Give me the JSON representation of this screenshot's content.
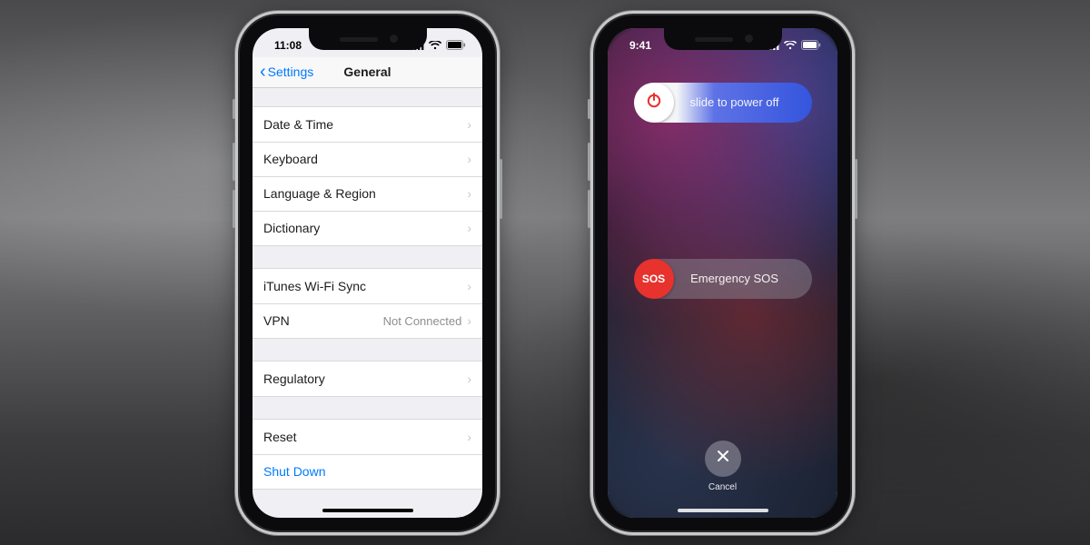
{
  "settings": {
    "status_time": "11:08",
    "back_label": "Settings",
    "title": "General",
    "rows": {
      "date_time": "Date & Time",
      "keyboard": "Keyboard",
      "language_region": "Language & Region",
      "dictionary": "Dictionary",
      "itunes_wifi": "iTunes Wi-Fi Sync",
      "vpn": "VPN",
      "vpn_status": "Not Connected",
      "regulatory": "Regulatory",
      "reset": "Reset",
      "shut_down": "Shut Down"
    }
  },
  "power": {
    "status_time": "9:41",
    "slide_label": "slide to power off",
    "sos_thumb": "SOS",
    "sos_label": "Emergency SOS",
    "cancel_label": "Cancel"
  },
  "colors": {
    "ios_blue": "#007aff",
    "sos_red": "#e8322d"
  }
}
